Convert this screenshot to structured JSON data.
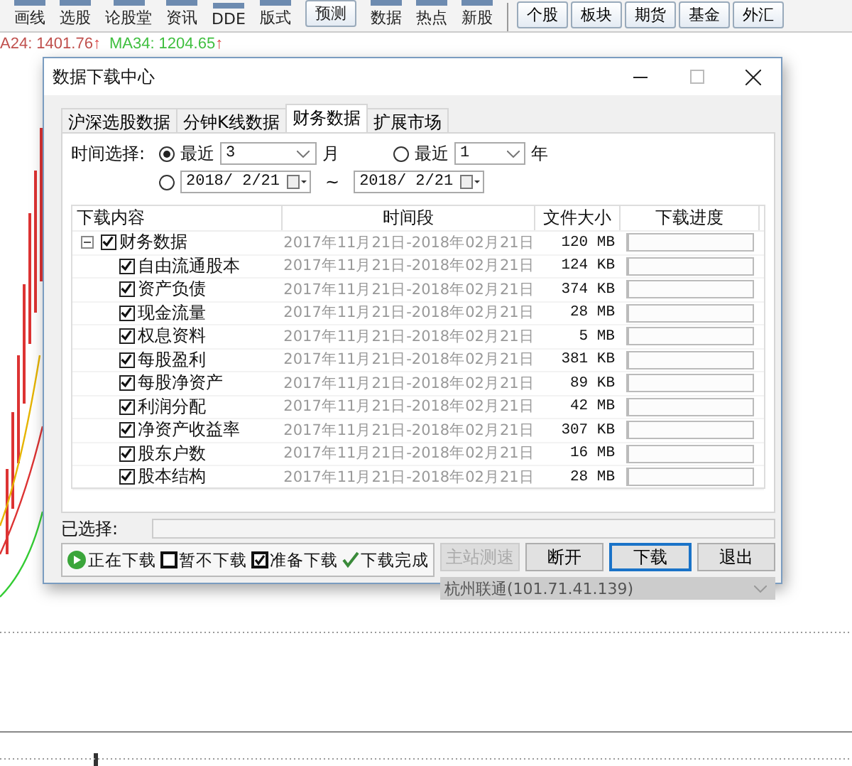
{
  "toolbar": {
    "items": [
      {
        "label": "画线",
        "kind": "icon"
      },
      {
        "label": "选股",
        "kind": "icon"
      },
      {
        "label": "论股堂",
        "kind": "icon"
      },
      {
        "label": "资讯",
        "kind": "icon"
      },
      {
        "label": "DDE",
        "kind": "icon"
      },
      {
        "label": "版式",
        "kind": "icon"
      },
      {
        "label": "预测",
        "kind": "button"
      },
      {
        "label": "数据",
        "kind": "icon"
      },
      {
        "label": "热点",
        "kind": "icon"
      },
      {
        "label": "新股",
        "kind": "icon"
      }
    ],
    "markets": [
      "个股",
      "板块",
      "期货",
      "基金",
      "外汇"
    ]
  },
  "indicators": [
    {
      "label": "A24: 1401.76",
      "arrow": "↑",
      "color": "#c0504d"
    },
    {
      "label": "MA34: 1204.65",
      "arrow": "↑",
      "color": "#3fbf3f"
    }
  ],
  "dialog": {
    "title": "数据下载中心",
    "tabs": [
      {
        "label": "沪深选股数据",
        "selected": false
      },
      {
        "label": "分钟K线数据",
        "selected": false
      },
      {
        "label": "财务数据",
        "selected": true
      },
      {
        "label": "扩展市场",
        "selected": false
      }
    ],
    "time_label": "时间选择:",
    "recent_month": {
      "label": "最近",
      "value": "3",
      "unit": "月",
      "selected": true
    },
    "recent_year": {
      "label": "最近",
      "value": "1",
      "unit": "年",
      "selected": false
    },
    "range": {
      "start": "2018/ 2/21",
      "separator": "~",
      "end": "2018/ 2/21",
      "selected": false
    },
    "columns": [
      "下载内容",
      "时间段",
      "文件大小",
      "下载进度"
    ],
    "tree": {
      "label": "财务数据",
      "checked": true,
      "expanded": true,
      "period": "2017年11月21日-2018年02月21日",
      "size": "120 MB",
      "level": 0,
      "children": [
        {
          "label": "自由流通股本",
          "checked": true,
          "period": "2017年11月21日-2018年02月21日",
          "size": "124 KB",
          "level": 0
        },
        {
          "label": "资产负债",
          "checked": true,
          "period": "2017年11月21日-2018年02月21日",
          "size": "374 KB",
          "level": 0
        },
        {
          "label": "现金流量",
          "checked": true,
          "period": "2017年11月21日-2018年02月21日",
          "size": "28 MB",
          "level": 0
        },
        {
          "label": "权息资料",
          "checked": true,
          "period": "2017年11月21日-2018年02月21日",
          "size": "5 MB",
          "level": 0
        },
        {
          "label": "每股盈利",
          "checked": true,
          "period": "2017年11月21日-2018年02月21日",
          "size": "381 KB",
          "level": 0
        },
        {
          "label": "每股净资产",
          "checked": true,
          "period": "2017年11月21日-2018年02月21日",
          "size": "89 KB",
          "level": 0
        },
        {
          "label": "利润分配",
          "checked": true,
          "period": "2017年11月21日-2018年02月21日",
          "size": "42 MB",
          "level": 0
        },
        {
          "label": "净资产收益率",
          "checked": true,
          "period": "2017年11月21日-2018年02月21日",
          "size": "307 KB",
          "level": 0
        },
        {
          "label": "股东户数",
          "checked": true,
          "period": "2017年11月21日-2018年02月21日",
          "size": "16 MB",
          "level": 0
        },
        {
          "label": "股本结构",
          "checked": true,
          "period": "2017年11月21日-2018年02月21日",
          "size": "28 MB",
          "level": 0
        }
      ]
    },
    "selected_label": "已选择:",
    "legend": [
      {
        "kind": "downloading",
        "label": "正在下载"
      },
      {
        "kind": "unchecked",
        "label": "暂不下载"
      },
      {
        "kind": "checked",
        "label": "准备下载"
      },
      {
        "kind": "done",
        "label": "下载完成"
      }
    ],
    "buttons": [
      {
        "label": "主站测速",
        "disabled": true,
        "focused": false
      },
      {
        "label": "断开",
        "disabled": false,
        "focused": false
      },
      {
        "label": "下载",
        "disabled": false,
        "focused": true
      },
      {
        "label": "退出",
        "disabled": false,
        "focused": false
      }
    ],
    "server": {
      "value": "杭州联通(101.71.41.139)",
      "disabled": true
    }
  }
}
